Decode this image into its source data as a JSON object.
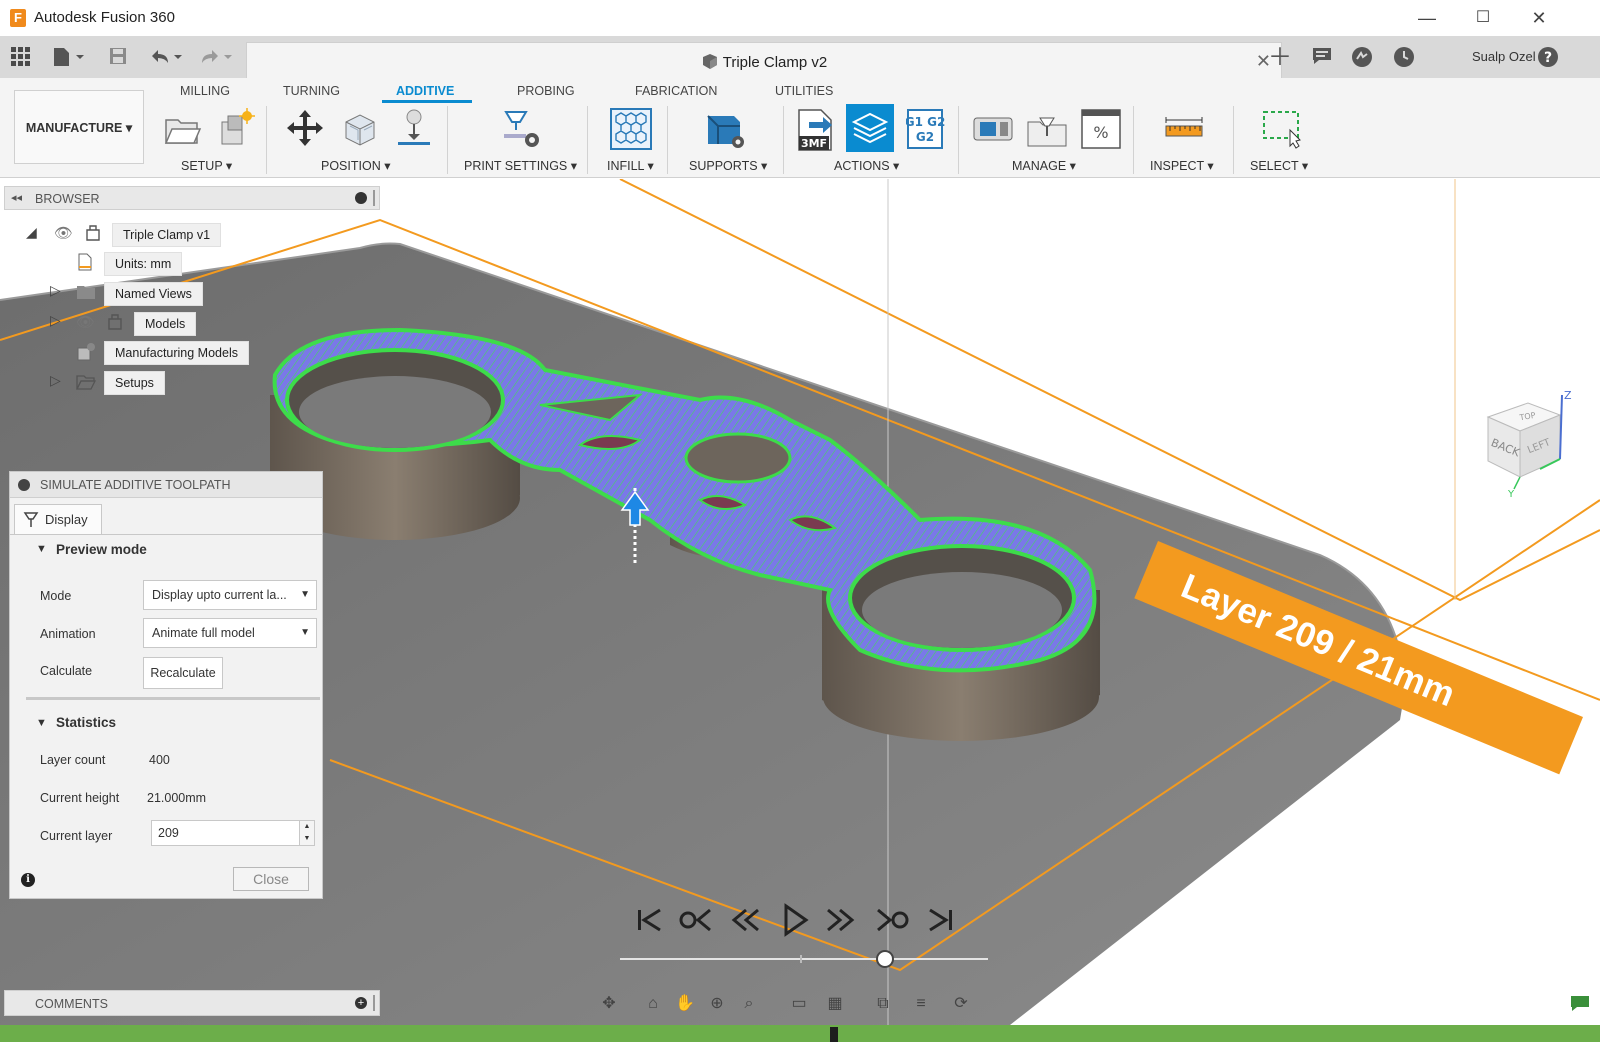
{
  "window": {
    "title": "Autodesk Fusion 360",
    "logo_letter": "F",
    "minimize": "—",
    "maximize": "☐",
    "close": "✕"
  },
  "document_tab": {
    "title": "Triple Clamp v2",
    "close": "✕"
  },
  "user": {
    "name": "Sualp Ozel"
  },
  "ribbon": {
    "workspace": "MANUFACTURE ▾",
    "tabs": [
      "MILLING",
      "TURNING",
      "ADDITIVE",
      "PROBING",
      "FABRICATION",
      "UTILITIES"
    ],
    "active_tab": "ADDITIVE",
    "groups": [
      "SETUP ▾",
      "POSITION ▾",
      "PRINT SETTINGS ▾",
      "INFILL ▾",
      "SUPPORTS ▾",
      "ACTIONS ▾",
      "MANAGE ▾",
      "INSPECT ▾",
      "SELECT ▾"
    ],
    "icon_labels": {
      "export_3mf": "3MF",
      "gcode": "G1 G2"
    }
  },
  "browser": {
    "title": "BROWSER",
    "items": [
      {
        "label": "Triple Clamp v1",
        "icon": "component-icon"
      },
      {
        "label": "Units: mm",
        "icon": "document-icon"
      },
      {
        "label": "Named Views",
        "icon": "folder-icon"
      },
      {
        "label": "Models",
        "icon": "component-icon"
      },
      {
        "label": "Manufacturing Models",
        "icon": "manufacturing-model-icon"
      },
      {
        "label": "Setups",
        "icon": "folder-open-icon"
      }
    ]
  },
  "viewport": {
    "layer_banner": "Layer 209 / 21mm",
    "viewcube": {
      "faces": [
        "TOP",
        "BACK",
        "LEFT"
      ],
      "axes": [
        "Z",
        "Y"
      ]
    }
  },
  "simulate_dialog": {
    "title": "SIMULATE ADDITIVE TOOLPATH",
    "tab": "Display",
    "preview_section": "Preview mode",
    "mode_label": "Mode",
    "mode_value": "Display upto current la...",
    "animation_label": "Animation",
    "animation_value": "Animate full model",
    "calculate_label": "Calculate",
    "calculate_button": "Recalculate",
    "stats_section": "Statistics",
    "layer_count_label": "Layer count",
    "layer_count_value": "400",
    "current_height_label": "Current height",
    "current_height_value": "21.000mm",
    "current_layer_label": "Current layer",
    "current_layer_value": "209",
    "close_button": "Close"
  },
  "playback": {
    "controls": [
      "go-to-start-icon",
      "previous-keyframe-icon",
      "step-back-icon",
      "play-icon",
      "step-forward-icon",
      "next-keyframe-icon",
      "go-to-end-icon"
    ],
    "position": 0.72
  },
  "comments": {
    "title": "COMMENTS"
  },
  "colors": {
    "accent": "#0a8bd0",
    "layer_banner": "#f39a1f",
    "status_bar": "#6cae4a",
    "toolpath_green": "#3ddc4a",
    "toolpath_blue": "#6b6ef0"
  }
}
